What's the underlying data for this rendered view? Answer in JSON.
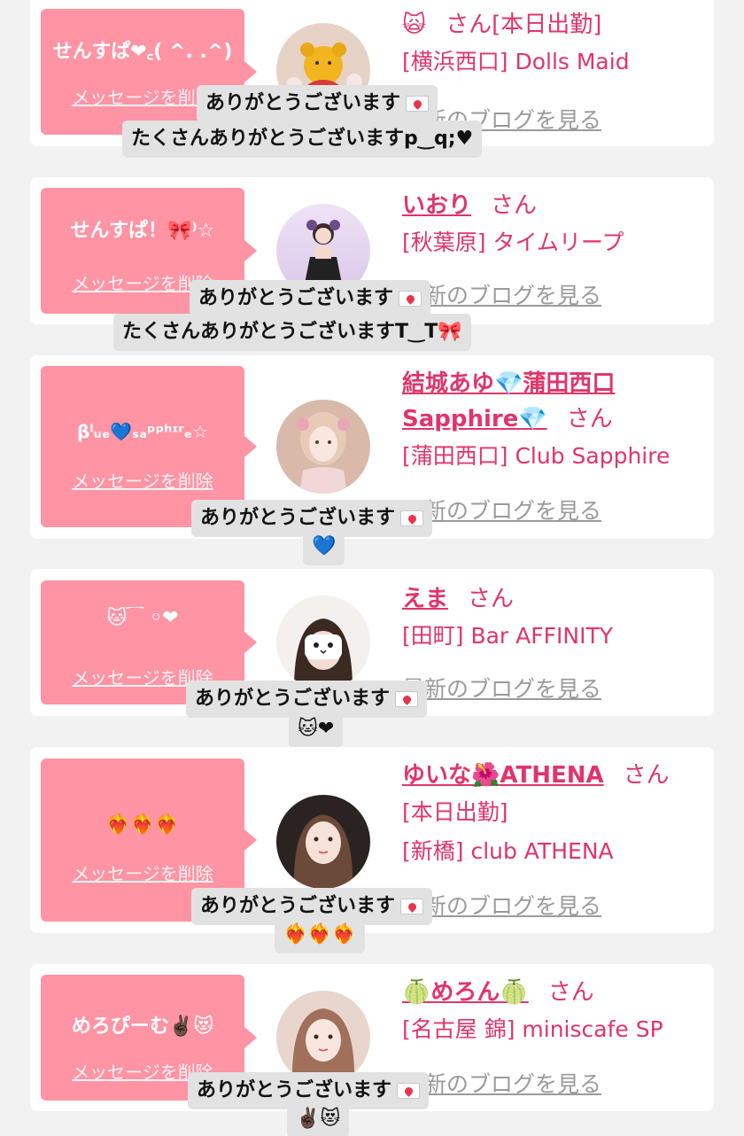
{
  "common": {
    "delete_label": "メッセージを削除",
    "san": "さん",
    "blog_label": "最新のブログを見る",
    "thanks": "ありがとうございます"
  },
  "cards": [
    {
      "message": "せんすぱ❤︎꜀( ^. .^)",
      "name": "🙀",
      "name_linked": false,
      "extra_line": "[本日出勤]",
      "store": "[横浜西口] Dolls Maid",
      "tip_line1": "ありがとうございます",
      "tip_line2": "たくさんありがとうございますp‿q;♥"
    },
    {
      "message": "せんすぱ！🎀⁾☆",
      "name": "いおり",
      "name_linked": true,
      "store": "[秋葉原] タイムリープ",
      "tip_line1": "ありがとうございます",
      "tip_line2": "たくさんありがとうございますT‿T🎀"
    },
    {
      "message": "βˡᵤₑ💙ₛₐᵖᵖʰᶦʳₑ☆",
      "name": "結城あゆ💎蒲田西口",
      "name2": "Sapphire💎",
      "name_linked": true,
      "store": "[蒲田西口] Club Sapphire",
      "tip_line1": "ありがとうございます",
      "tip_line2": "💙"
    },
    {
      "message": "🐱⁀ ◦❤",
      "name": "えま",
      "name_linked": true,
      "store": "[田町] Bar AFFINITY",
      "tip_line1": "ありがとうございます",
      "tip_line2": "🐱❤"
    },
    {
      "message": "❤‍🔥❤‍🔥❤‍🔥",
      "name": "ゆいな🌺ATHENA",
      "name_linked": true,
      "extra_line": "[本日出勤]",
      "store": "[新橋] club ATHENA",
      "tip_line1": "ありがとうございます",
      "tip_line2": "❤‍🔥❤‍🔥❤‍🔥"
    },
    {
      "message": "めろぴーむ✌🏿😻",
      "name": "🍈めろん🍈",
      "name_linked": true,
      "store": "[名古屋 錦] miniscafe SP",
      "tip_line1": "ありがとうございます",
      "tip_line2": "✌🏿😻"
    }
  ],
  "colors": {
    "bubble": "#ff94a4",
    "accent": "#e0356a",
    "blog": "#9a9a9a",
    "background": "#f2f2f2"
  }
}
